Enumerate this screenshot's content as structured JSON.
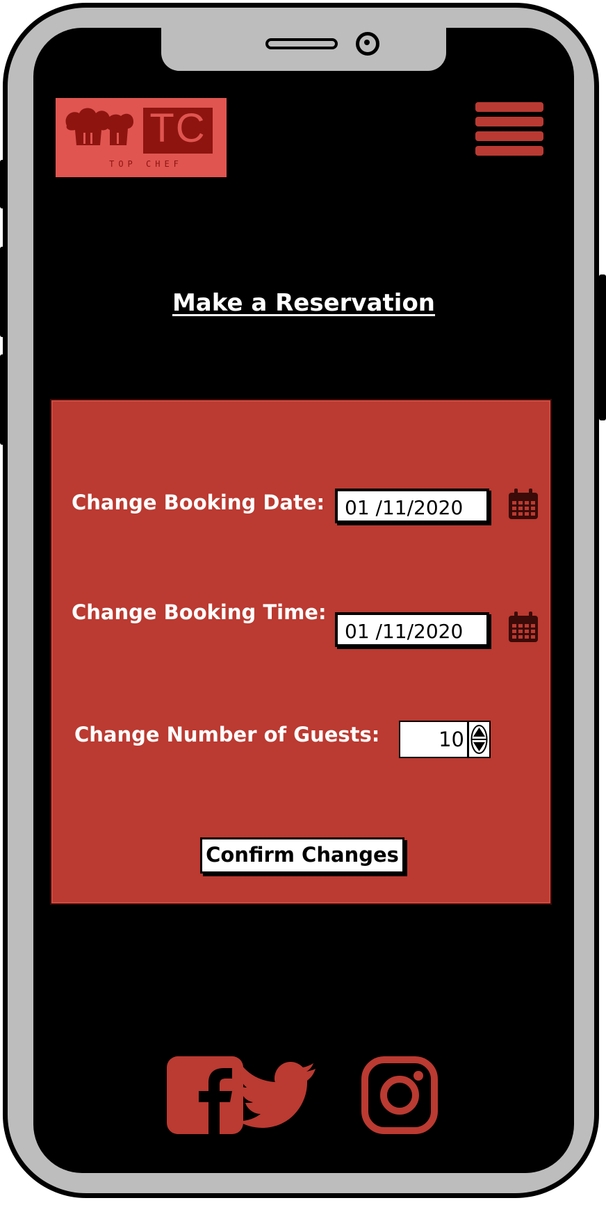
{
  "logo": {
    "monogram": "TC",
    "tagline": "TOP CHEF"
  },
  "icons": {
    "menu": "hamburger-menu-icon",
    "calendar": "calendar-icon",
    "facebook": "facebook-icon",
    "twitter": "twitter-icon",
    "instagram": "instagram-icon"
  },
  "colors": {
    "accent": "#bb3a31",
    "logo_bg": "#e05550",
    "logo_dark": "#8e1410",
    "screen_bg": "#000000",
    "frame": "#bdbdbd"
  },
  "page": {
    "title": "Make a Reservation"
  },
  "form": {
    "date_label": "Change Booking Date:",
    "date_value": "01 /11/2020",
    "time_label": "Change Booking Time:",
    "time_value": "01 /11/2020",
    "guests_label": "Change Number of Guests:",
    "guests_value": "10",
    "confirm_label": "Confirm Changes"
  }
}
